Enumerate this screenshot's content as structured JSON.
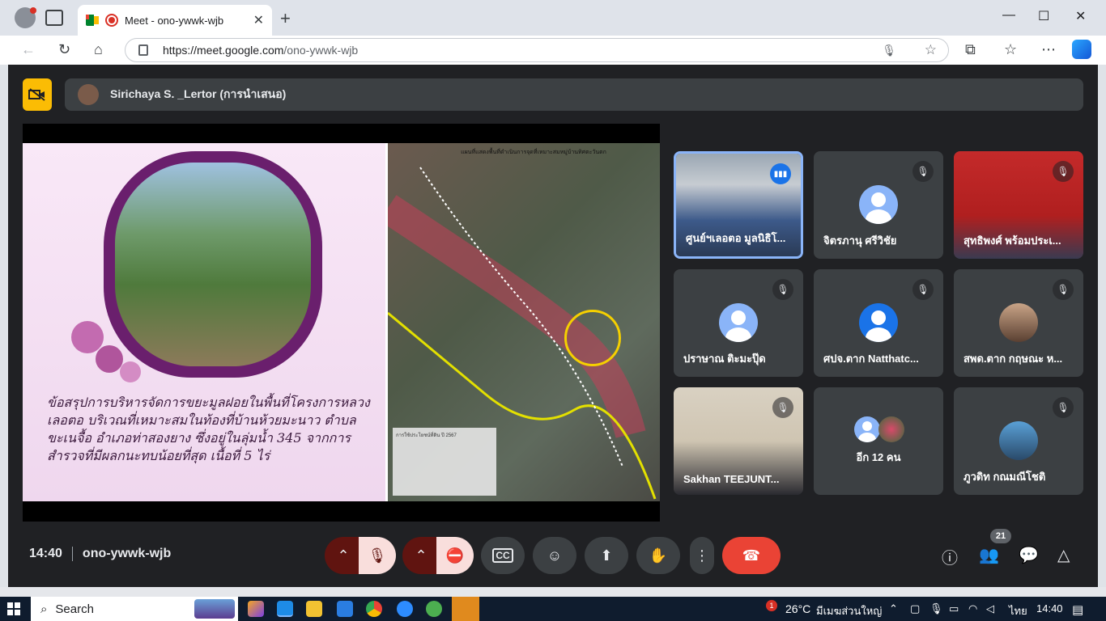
{
  "browser": {
    "tab_title": "Meet - ono-ywwk-wjb",
    "tab_close": "✕",
    "new_tab": "+",
    "minimize": "—",
    "maximize": "☐",
    "close": "✕",
    "url_host": "https://meet.google.com",
    "url_path": "/ono-ywwk-wjb"
  },
  "meet": {
    "presenter": "Sirichaya S. _Lertor (การนำเสนอ)",
    "slide": {
      "text": "ข้อสรุปการบริหารจัดการขยะมูลฝอยในพื้นที่โครงการหลวงเลอตอ บริเวณที่เหมาะสมในท้องที่บ้านห้วยมะนาว ตำบลขะเนจื้อ อำเภอท่าสองยาง ซึ่งอยู่ในลุ่มน้ำ 345 จากการสำรวจที่มีผลกนะทบน้อยที่สุด เนื้อที่ 5 ไร่",
      "map_title": "แผนที่แสดงพื้นที่ดำเนินการจุดที่เหมาะสมหมู่บ้านทิศตะวันตก",
      "legend_title": "การใช้ประโยชน์ที่ดิน ปี 2567"
    },
    "participants": [
      {
        "name": "ศูนย์ฯเลอตอ มูลนิธิโ...",
        "speaking": true
      },
      {
        "name": "จิตรภานุ ศรีวิชัย",
        "muted": true
      },
      {
        "name": "สุทธิพงศ์ พร้อมประเ...",
        "muted": true
      },
      {
        "name": "ปราษาณ ติะมะปุ๊ด",
        "muted": true
      },
      {
        "name": "ศปจ.ตาก Natthatc...",
        "muted": true
      },
      {
        "name": "สพด.ตาก กฤษณะ ห...",
        "muted": true
      },
      {
        "name": "Sakhan TEEJUNT...",
        "muted": true
      },
      {
        "name": "อีก 12 คน"
      },
      {
        "name": "ภูวดิท กณมณีโชติ",
        "muted": true
      }
    ],
    "time": "14:40",
    "meeting_code": "ono-ywwk-wjb",
    "people_count": "21",
    "icons": {
      "mic_off": "🎙",
      "cam_off": "⛔",
      "captions": "CC",
      "emoji": "☺",
      "present": "⬆",
      "hand": "✋",
      "more": "⋮",
      "end": "☎",
      "info": "ⓘ",
      "people": "👥",
      "chat": "💬",
      "activities": "△"
    }
  },
  "taskbar": {
    "search": "Search",
    "weather": "26°C",
    "location": "มีเมฆส่วนใหญ่",
    "lang": "ไทย",
    "time": "14:40",
    "notif": "1"
  }
}
